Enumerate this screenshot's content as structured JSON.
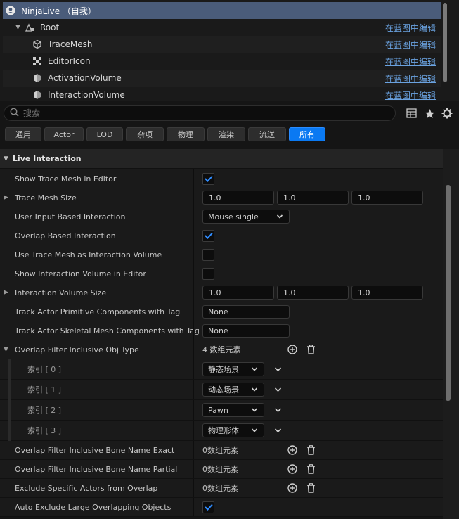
{
  "tree": {
    "items": [
      {
        "label": "NinjaLive （自我）",
        "icon": "actor-icon",
        "selected": true
      },
      {
        "label": "Root",
        "icon": "scene-root-icon",
        "link": "在蓝图中编辑"
      },
      {
        "label": "TraceMesh",
        "icon": "static-mesh-icon",
        "link": "在蓝图中编辑"
      },
      {
        "label": "EditorIcon",
        "icon": "billboard-icon",
        "link": "在蓝图中编辑"
      },
      {
        "label": "ActivationVolume",
        "icon": "volume-icon",
        "link": "在蓝图中编辑"
      },
      {
        "label": "InteractionVolume",
        "icon": "volume-icon",
        "link": "在蓝图中编辑"
      }
    ]
  },
  "search": {
    "placeholder": "搜索"
  },
  "filters": [
    "通用",
    "Actor",
    "LOD",
    "杂项",
    "物理",
    "渲染",
    "流送",
    "所有"
  ],
  "active_filter": "所有",
  "category": {
    "title": "Live Interaction"
  },
  "props": {
    "show_trace_mesh": {
      "label": "Show Trace Mesh in Editor",
      "checked": true
    },
    "trace_mesh_size": {
      "label": "Trace Mesh Size",
      "x": "1.0",
      "y": "1.0",
      "z": "1.0"
    },
    "user_input": {
      "label": "User Input Based Interaction",
      "value": "Mouse single"
    },
    "overlap_based": {
      "label": "Overlap Based Interaction",
      "checked": true
    },
    "use_trace_mesh": {
      "label": "Use Trace Mesh as Interaction Volume",
      "checked": false
    },
    "show_volume": {
      "label": "Show Interaction Volume in Editor",
      "checked": false
    },
    "volume_size": {
      "label": "Interaction Volume Size",
      "x": "1.0",
      "y": "1.0",
      "z": "1.0"
    },
    "primitive_tag": {
      "label": "Track Actor Primitive Components with Tag",
      "value": "None"
    },
    "skeletal_tag": {
      "label": "Track Actor Skeletal Mesh Components with Tag",
      "value": "None"
    },
    "obj_type": {
      "label": "Overlap Filter Inclusive Obj Type",
      "count": "4 数组元素",
      "elements": [
        {
          "label": "索引 [ 0 ]",
          "value": "静态场景"
        },
        {
          "label": "索引 [ 1 ]",
          "value": "动态场景"
        },
        {
          "label": "索引 [ 2 ]",
          "value": "Pawn"
        },
        {
          "label": "索引 [ 3 ]",
          "value": "物理形体"
        }
      ]
    },
    "bone_exact": {
      "label": "Overlap Filter Inclusive Bone Name Exact",
      "count": "0数组元素"
    },
    "bone_partial": {
      "label": "Overlap Filter Inclusive Bone Name Partial",
      "count": "0数组元素"
    },
    "exclude_actors": {
      "label": "Exclude Specific Actors from Overlap",
      "count": "0数组元素"
    },
    "auto_exclude": {
      "label": "Auto Exclude Large Overlapping Objects",
      "checked": true
    }
  },
  "colors": {
    "accent": "#0a79f2",
    "selection": "#4a5c7a",
    "link": "#6aa2e0",
    "check": "#2f8cff"
  }
}
